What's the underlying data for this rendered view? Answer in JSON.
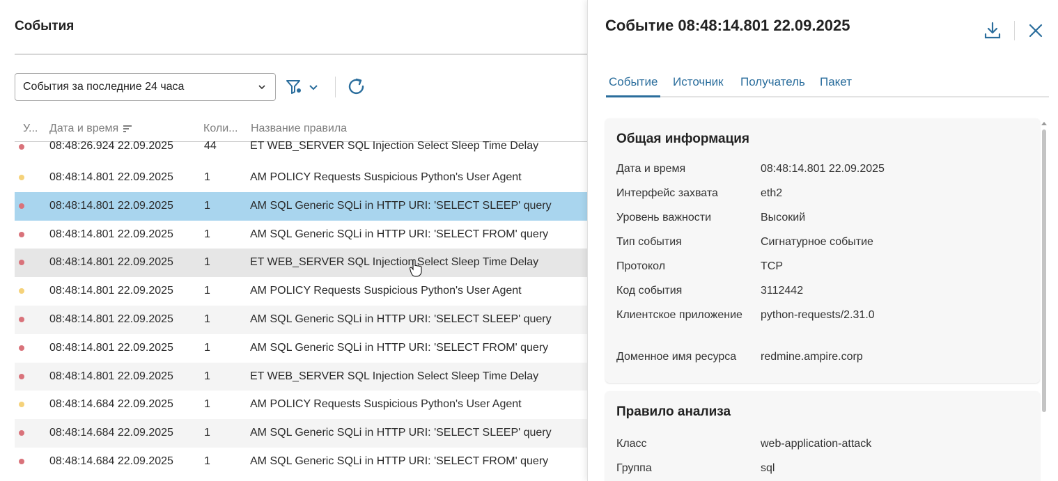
{
  "events": {
    "title": "События",
    "period_select": {
      "value": "События за последние 24 часа"
    },
    "columns": {
      "status": "У...",
      "datetime": "Дата и время",
      "count": "Коли...",
      "rule": "Название правила"
    },
    "rows": [
      {
        "severity": "high",
        "datetime": "08:48:26.924 22.09.2025",
        "count": "44",
        "rule": "ET WEB_SERVER SQL Injection Select Sleep Time Delay"
      },
      {
        "severity": "low",
        "datetime": "08:48:14.801 22.09.2025",
        "count": "1",
        "rule": "AM POLICY Requests Suspicious Python's User Agent"
      },
      {
        "severity": "high",
        "datetime": "08:48:14.801 22.09.2025",
        "count": "1",
        "rule": "AM SQL Generic SQLi in HTTP URI: 'SELECT SLEEP' query"
      },
      {
        "severity": "high",
        "datetime": "08:48:14.801 22.09.2025",
        "count": "1",
        "rule": "AM SQL Generic SQLi in HTTP URI: 'SELECT FROM' query"
      },
      {
        "severity": "high",
        "datetime": "08:48:14.801 22.09.2025",
        "count": "1",
        "rule": "ET WEB_SERVER SQL Injection Select Sleep Time Delay"
      },
      {
        "severity": "low",
        "datetime": "08:48:14.801 22.09.2025",
        "count": "1",
        "rule": "AM POLICY Requests Suspicious Python's User Agent"
      },
      {
        "severity": "high",
        "datetime": "08:48:14.801 22.09.2025",
        "count": "1",
        "rule": "AM SQL Generic SQLi in HTTP URI: 'SELECT SLEEP' query"
      },
      {
        "severity": "high",
        "datetime": "08:48:14.801 22.09.2025",
        "count": "1",
        "rule": "AM SQL Generic SQLi in HTTP URI: 'SELECT FROM' query"
      },
      {
        "severity": "high",
        "datetime": "08:48:14.801 22.09.2025",
        "count": "1",
        "rule": "ET WEB_SERVER SQL Injection Select Sleep Time Delay"
      },
      {
        "severity": "low",
        "datetime": "08:48:14.684 22.09.2025",
        "count": "1",
        "rule": "AM POLICY Requests Suspicious Python's User Agent"
      },
      {
        "severity": "high",
        "datetime": "08:48:14.684 22.09.2025",
        "count": "1",
        "rule": "AM SQL Generic SQLi in HTTP URI: 'SELECT SLEEP' query"
      },
      {
        "severity": "high",
        "datetime": "08:48:14.684 22.09.2025",
        "count": "1",
        "rule": "AM SQL Generic SQLi in HTTP URI: 'SELECT FROM' query"
      }
    ],
    "selected_row": 2,
    "hovered_row": 4
  },
  "colors": {
    "severity_high": "#d9727a",
    "severity_low": "#f5d27a",
    "selected_row": "#a9d5ee",
    "accent": "#2a6d9c"
  },
  "detail": {
    "title": "Событие 08:48:14.801 22.09.2025",
    "tabs": [
      "Событие",
      "Источник",
      "Получатель",
      "Пакет"
    ],
    "active_tab": 0,
    "general": {
      "heading": "Общая информация",
      "fields": [
        {
          "key": "Дата и время",
          "value": "08:48:14.801 22.09.2025"
        },
        {
          "key": "Интерфейс захвата",
          "value": "eth2"
        },
        {
          "key": "Уровень важности",
          "value": "Высокий"
        },
        {
          "key": "Тип события",
          "value": "Сигнатурное событие"
        },
        {
          "key": "Протокол",
          "value": "TCP"
        },
        {
          "key": "Код события",
          "value": "3112442"
        },
        {
          "key": "Клиентское приложение",
          "value": "python-requests/2.31.0"
        },
        {
          "key": "Доменное имя ресурса",
          "value": "redmine.ampire.corp"
        }
      ]
    },
    "rule": {
      "heading": "Правило анализа",
      "fields": [
        {
          "key": "Класс",
          "value": "web-application-attack"
        },
        {
          "key": "Группа",
          "value": "sql"
        }
      ]
    }
  },
  "icons": {
    "period_chevron": "chevron-down-icon",
    "filter": "filter-icon",
    "filter_chevron": "chevron-down-icon",
    "refresh": "refresh-icon",
    "sort": "sort-icon",
    "download": "download-icon",
    "close": "close-icon"
  }
}
